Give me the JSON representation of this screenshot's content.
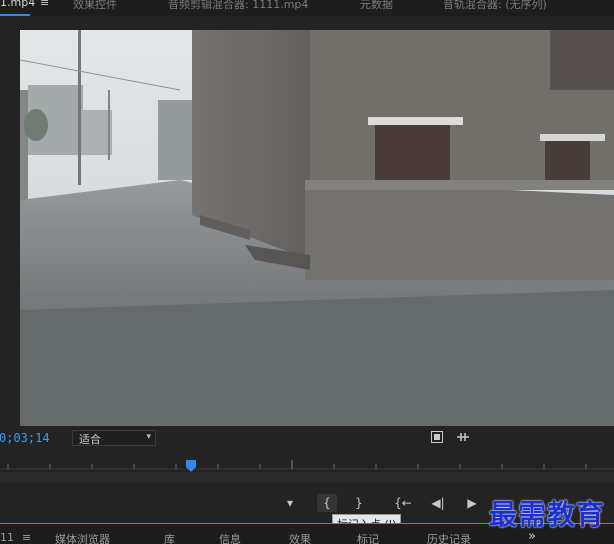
{
  "top_tabs": {
    "source_label": "1.mp4",
    "menu_symbol": "≡",
    "effect_controls": "效果控件",
    "audio_clip_mixer": "音频剪辑混合器: 1111.mp4",
    "metadata": "元数据",
    "audio_track_mixer": "音轨混合器: (无序列)"
  },
  "controls": {
    "timecode": "0;03;14",
    "fit_value": "适合",
    "chevron": "▾"
  },
  "transport": {
    "marker": "▾",
    "mark_in": "{",
    "mark_out": "}",
    "go_to_in": "{←",
    "step_back": "◀|",
    "play": "▶",
    "tooltip": "标记入点 (I)"
  },
  "bottom_tabs": {
    "prefix": "11",
    "menu": "≡",
    "media_browser": "媒体浏览器",
    "library": "库",
    "info": "信息",
    "effects": "效果",
    "markers": "标记",
    "history": "历史记录",
    "more": "»"
  },
  "watermark": "最需教育",
  "colors": {
    "accent": "#2d8ceb",
    "timecode": "#3b9cf0",
    "playhead": "#2d8ceb",
    "watermark": "#1c2fd0"
  }
}
